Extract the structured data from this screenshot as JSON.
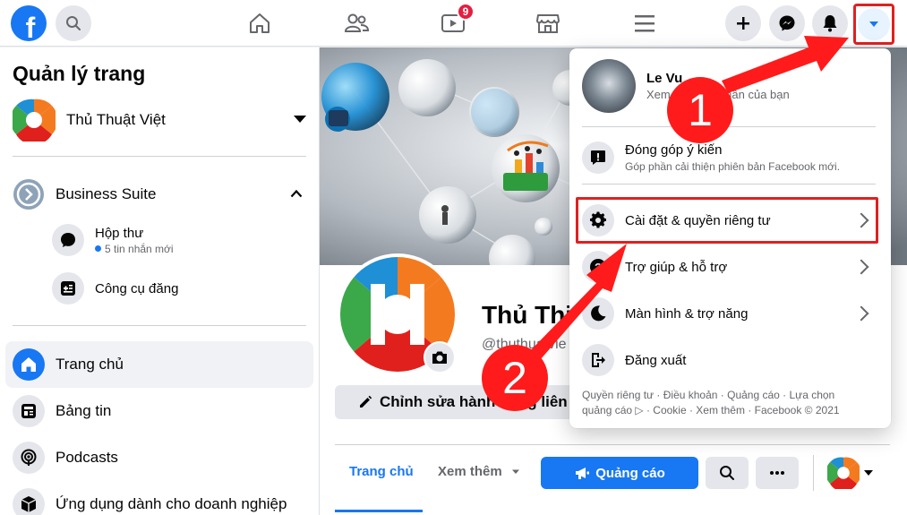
{
  "topbar": {
    "logo": "f",
    "icons": [
      "search-icon",
      "home-icon",
      "friends-icon",
      "watch-icon",
      "marketplace-icon",
      "menu-icon",
      "plus-icon",
      "messenger-icon",
      "bell-icon",
      "caret-down-icon"
    ],
    "watch_badge": "9"
  },
  "sidebar": {
    "title": "Quản lý trang",
    "page_name": "Thủ Thuật Việt",
    "business_suite": "Business Suite",
    "inbox": {
      "label": "Hộp thư",
      "meta": "5 tin nhắn mới"
    },
    "publishing_tools": "Công cụ đăng",
    "nav": [
      {
        "label": "Trang chủ",
        "icon": "home-icon"
      },
      {
        "label": "Bảng tin",
        "icon": "news-feed-icon"
      },
      {
        "label": "Podcasts",
        "icon": "podcast-icon"
      },
      {
        "label": "Ứng dụng dành cho doanh nghiệp",
        "icon": "box-icon"
      }
    ]
  },
  "main": {
    "page_name": "Thủ Thi",
    "handle": "@thuthuatvie",
    "edit_button": "Chỉnh sửa hành động liên h",
    "tabs": {
      "home": "Trang chủ",
      "more": "Xem thêm"
    },
    "ads_button": "Quảng cáo"
  },
  "dropdown": {
    "profile_name": "Le Vu",
    "profile_sub": "Xem trang cá nhân của bạn",
    "feedback_title": "Đóng góp ý kiến",
    "feedback_sub": "Góp phần cải thiện phiên bản Facebook mới.",
    "items": [
      {
        "label": "Cài đặt & quyền riêng tư",
        "icon": "gear-icon"
      },
      {
        "label": "Trợ giúp & hỗ trợ",
        "icon": "help-icon"
      },
      {
        "label": "Màn hình & trợ năng",
        "icon": "moon-icon"
      },
      {
        "label": "Đăng xuất",
        "icon": "logout-icon"
      }
    ],
    "footer_line1": "Quyền riêng tư · Điều khoản · Quảng cáo · Lựa chọn",
    "footer_line2": "quảng cáo ▷ · Cookie · Xem thêm · Facebook © 2021"
  },
  "annotations": {
    "step1": "1",
    "step2": "2"
  },
  "colors": {
    "brand": "#1877f2",
    "annotation_red": "#ff1b1b",
    "highlight_border": "#e02020"
  }
}
